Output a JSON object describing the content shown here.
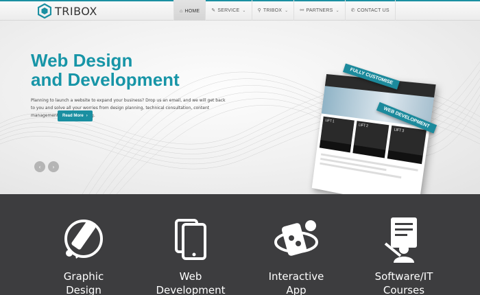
{
  "brand": {
    "name": "TRIBOX",
    "color": "#1a8fa1"
  },
  "nav": [
    {
      "label": "HOME",
      "icon": "home-icon",
      "glyph": "⌂",
      "caret": "",
      "active": true
    },
    {
      "label": "SERVICE",
      "icon": "edit-icon",
      "glyph": "✎",
      "caret": "⌄"
    },
    {
      "label": "TRIBOX",
      "icon": "search-icon",
      "glyph": "⚲",
      "caret": "⌄"
    },
    {
      "label": "PARTNERS",
      "icon": "link-icon",
      "glyph": "⚯",
      "caret": "⌄"
    },
    {
      "label": "CONTACT US",
      "icon": "phone-icon",
      "glyph": "✆",
      "caret": ""
    }
  ],
  "hero": {
    "title_line1": "Web Design",
    "title_line2": "and Development",
    "text": "Planning to launch a website to expand your business? Drop us an email, and we will get back to you and solve all your worries from design planning, technical consultation, content management, to even training.",
    "read_more": "Read More",
    "read_more_arrow": "›",
    "prev_glyph": "‹",
    "next_glyph": "›",
    "mockup": {
      "tag_full": "FULLY CUSTOMISE",
      "tag_web": "WEB DEVELOPMENT",
      "lifts": [
        "LIFT 1",
        "LIFT 2",
        "LIFT 3"
      ]
    }
  },
  "services": [
    {
      "line1": "Graphic",
      "line2": "Design",
      "icon": "graphic-design-icon"
    },
    {
      "line1": "Web",
      "line2": "Development",
      "icon": "web-development-icon"
    },
    {
      "line1": "Interactive",
      "line2": "App",
      "icon": "interactive-app-icon"
    },
    {
      "line1": "Software/IT",
      "line2": "Courses",
      "icon": "software-courses-icon"
    }
  ],
  "colors": {
    "accent": "#1795a7",
    "services_bg": "#3d3d3f"
  }
}
